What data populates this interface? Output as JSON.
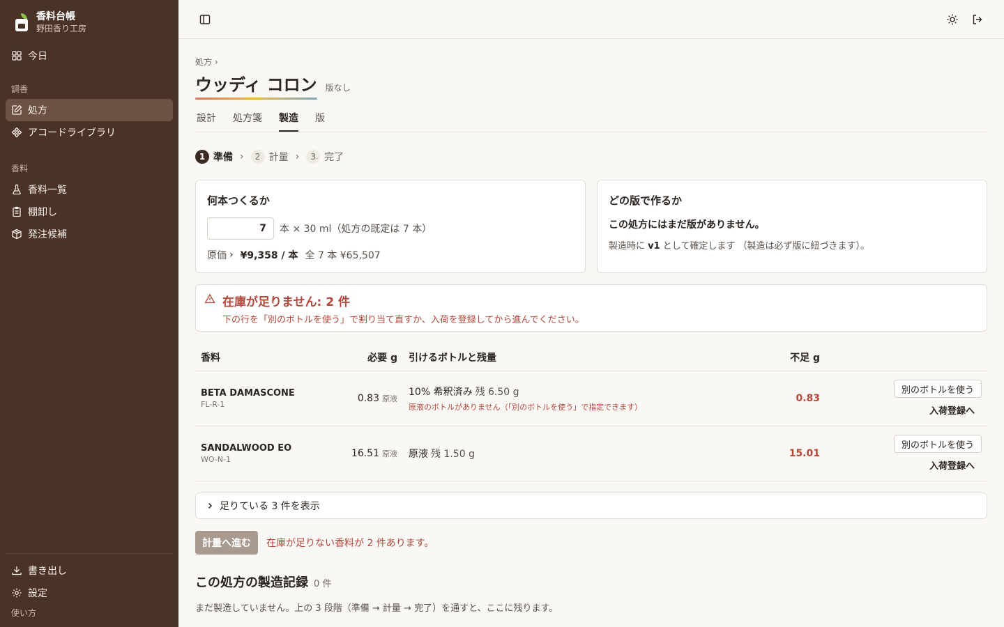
{
  "brand": {
    "title": "香料台帳",
    "subtitle": "野田香り工房"
  },
  "sidebar": {
    "today": "今日",
    "group1": "調香",
    "recipe": "処方",
    "accord": "アコードライブラリ",
    "group2": "香料",
    "materials": "香料一覧",
    "inventory": "棚卸し",
    "order": "発注候補",
    "export": "書き出し",
    "settings": "設定",
    "help": "使い方"
  },
  "header": {
    "breadcrumb": "処方 ›",
    "title": "ウッディ コロン",
    "version_badge": "版なし",
    "tabs": [
      "設計",
      "処方箋",
      "製造",
      "版"
    ]
  },
  "stepper": {
    "steps": [
      {
        "num": "1",
        "label": "準備"
      },
      {
        "num": "2",
        "label": "計量"
      },
      {
        "num": "3",
        "label": "完了"
      }
    ]
  },
  "quantity_card": {
    "title": "何本つくるか",
    "quantity": "7",
    "unit_text": "本 × 30 ml（処方の既定は 7 本）",
    "cost_label": "原価",
    "cost_per": "¥9,358 / 本",
    "cost_total": "全 7 本 ¥65,507"
  },
  "version_card": {
    "title": "どの版で作るか",
    "line1": "この処方にはまだ版がありません。",
    "line2_pre": "製造時に ",
    "line2_ver": "v1",
    "line2_post": " として確定します （製造は必ず版に紐づきます）。"
  },
  "alert": {
    "title": "在庫が足りません: 2 件",
    "desc": "下の行を「別のボトルを使う」で割り当て直すか、入荷を登録してから進んでください。"
  },
  "table": {
    "headers": {
      "material": "香料",
      "required": "必要 g",
      "bottle": "引けるボトルと残量",
      "shortage": "不足 g"
    },
    "rows": [
      {
        "name": "BETA DAMASCONE",
        "code": "FL-R-1",
        "required": "0.83",
        "required_unit": "原液",
        "bottle": "10% 希釈済み",
        "remaining": "残 6.50 g",
        "note": "原液のボトルがありません（「別のボトルを使う」で指定できます）",
        "shortage": "0.83",
        "btn_other": "別のボトルを使う",
        "btn_receive": "入荷登録へ"
      },
      {
        "name": "SANDALWOOD EO",
        "code": "WO-N-1",
        "required": "16.51",
        "required_unit": "原液",
        "bottle": "原液",
        "remaining": "残 1.50 g",
        "note": "",
        "shortage": "15.01",
        "btn_other": "別のボトルを使う",
        "btn_receive": "入荷登録へ"
      }
    ]
  },
  "collapse": {
    "label": "足りている 3 件を表示"
  },
  "proceed": {
    "button": "計量へ進む",
    "note": "在庫が足りない香料が 2 件あります。"
  },
  "records": {
    "title": "この処方の製造記録",
    "count": "0 件",
    "empty": "まだ製造していません。上の 3 段階（準備 → 計量 → 完了）を通すと、ここに残ります。"
  },
  "colors": {
    "sidebar": "#4a3226",
    "danger": "#b5473a",
    "accent_active": "#6d5144"
  }
}
